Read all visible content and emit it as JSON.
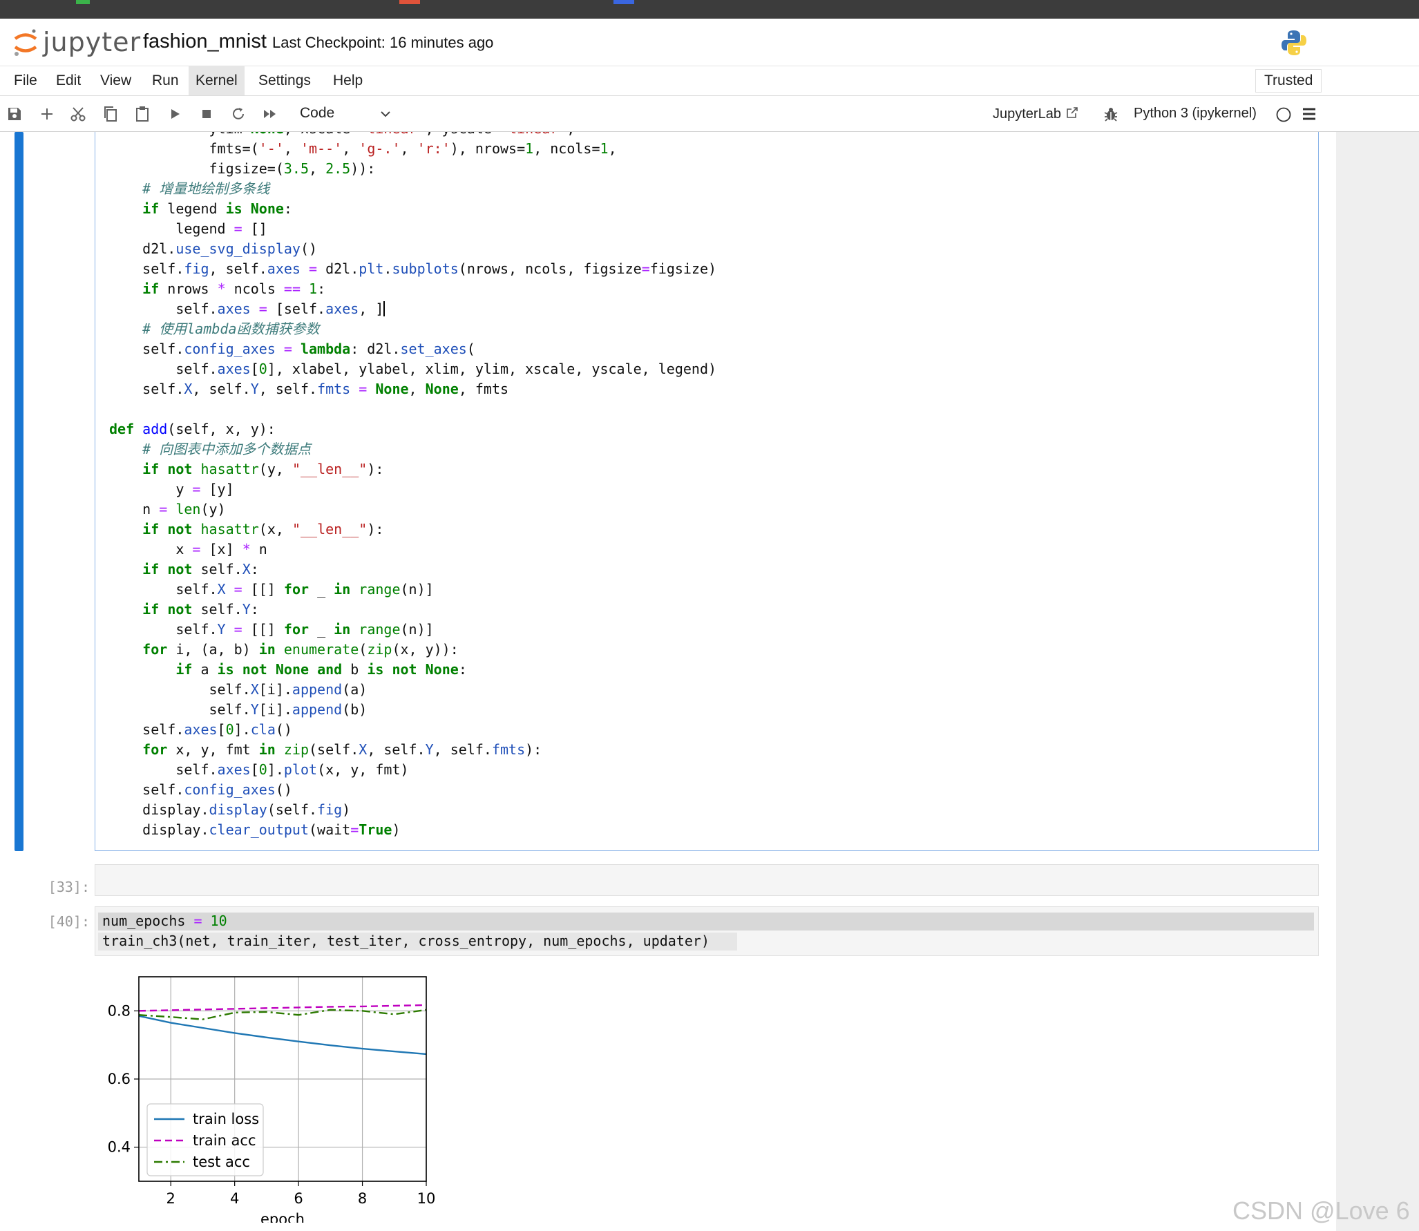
{
  "header": {
    "app_name": "jupyter",
    "notebook_title": "fashion_mnist",
    "checkpoint": "Last Checkpoint: 16 minutes ago"
  },
  "menu": {
    "items": [
      "File",
      "Edit",
      "View",
      "Run",
      "Kernel",
      "Settings",
      "Help"
    ],
    "active": "Kernel",
    "trusted": "Trusted"
  },
  "toolbar": {
    "cell_type": "Code",
    "jupyterlab_label": "JupyterLab",
    "kernel": "Python 3 (ipykernel)"
  },
  "cells": {
    "active_code_lines": [
      "            ylim=None, xscale='linear', yscale='linear',",
      "            fmts=('-', 'm--', 'g-.', 'r:'), nrows=1, ncols=1,",
      "            figsize=(3.5, 2.5)):",
      "    # 增量地绘制多条线",
      "    if legend is None:",
      "        legend = []",
      "    d2l.use_svg_display()",
      "    self.fig, self.axes = d2l.plt.subplots(nrows, ncols, figsize=figsize)",
      "    if nrows * ncols == 1:",
      "        self.axes = [self.axes, ]",
      "    # 使用lambda函数捕获参数",
      "    self.config_axes = lambda: d2l.set_axes(",
      "        self.axes[0], xlabel, ylabel, xlim, ylim, xscale, yscale, legend)",
      "    self.X, self.Y, self.fmts = None, None, fmts",
      "",
      "def add(self, x, y):",
      "    # 向图表中添加多个数据点",
      "    if not hasattr(y, \"__len__\"):",
      "        y = [y]",
      "    n = len(y)",
      "    if not hasattr(x, \"__len__\"):",
      "        x = [x] * n",
      "    if not self.X:",
      "        self.X = [[] for _ in range(n)]",
      "    if not self.Y:",
      "        self.Y = [[] for _ in range(n)]",
      "    for i, (a, b) in enumerate(zip(x, y)):",
      "        if a is not None and b is not None:",
      "            self.X[i].append(a)",
      "            self.Y[i].append(b)",
      "    self.axes[0].cla()",
      "    for x, y, fmt in zip(self.X, self.Y, self.fmts):",
      "        self.axes[0].plot(x, y, fmt)",
      "    self.config_axes()",
      "    display.display(self.fig)",
      "    display.clear_output(wait=True)"
    ],
    "cell33_prompt": "[33]:",
    "cell40_prompt": "[40]:",
    "cell40_line1": "num_epochs = 10",
    "cell40_line2": "train_ch3(net, train_iter, test_iter, cross_entropy, num_epochs, updater)"
  },
  "chart_data": {
    "type": "line",
    "title": "",
    "xlabel": "epoch",
    "ylabel": "",
    "xlim": [
      1,
      10
    ],
    "ylim": [
      0.3,
      0.9
    ],
    "xticks": [
      2,
      4,
      6,
      8,
      10
    ],
    "yticks": [
      0.4,
      0.6,
      0.8
    ],
    "grid": true,
    "legend_position": "lower-left",
    "x": [
      1,
      2,
      3,
      4,
      5,
      6,
      7,
      8,
      9,
      10
    ],
    "series": [
      {
        "name": "train loss",
        "style": "solid",
        "color": "#1f77b4",
        "values": [
          0.785,
          0.765,
          0.75,
          0.735,
          0.722,
          0.71,
          0.699,
          0.689,
          0.681,
          0.673
        ]
      },
      {
        "name": "train acc",
        "style": "dashed",
        "color": "#bf00bf",
        "values": [
          0.8,
          0.802,
          0.804,
          0.806,
          0.808,
          0.81,
          0.812,
          0.813,
          0.815,
          0.817
        ]
      },
      {
        "name": "test acc",
        "style": "dashdot",
        "color": "#2c7a00",
        "values": [
          0.788,
          0.782,
          0.775,
          0.795,
          0.797,
          0.788,
          0.803,
          0.8,
          0.79,
          0.803
        ]
      }
    ]
  },
  "watermark": "CSDN @Love 6"
}
